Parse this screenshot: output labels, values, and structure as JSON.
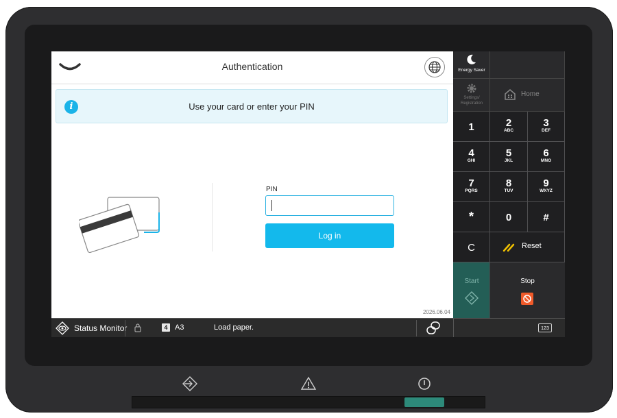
{
  "header": {
    "title": "Authentication"
  },
  "info_banner": {
    "message": "Use your card or enter your PIN"
  },
  "login_form": {
    "pin_label": "PIN",
    "pin_value": "",
    "login_button": "Log in"
  },
  "date": "2026.06.04",
  "status_bar": {
    "status_monitor": "Status Monitor",
    "tray_number": "4",
    "paper_size": "A3",
    "message": "Load paper.",
    "keyboard_label": "123"
  },
  "side_panel": {
    "energy_saver": "Energy Saver",
    "settings": "Settings/ Registration",
    "home": "Home",
    "reset": "Reset",
    "start": "Start",
    "stop": "Stop",
    "keys": [
      {
        "digit": "1",
        "letters": ""
      },
      {
        "digit": "2",
        "letters": "ABC"
      },
      {
        "digit": "3",
        "letters": "DEF"
      },
      {
        "digit": "4",
        "letters": "GHI"
      },
      {
        "digit": "5",
        "letters": "JKL"
      },
      {
        "digit": "6",
        "letters": "MNO"
      },
      {
        "digit": "7",
        "letters": "PQRS"
      },
      {
        "digit": "8",
        "letters": "TUV"
      },
      {
        "digit": "9",
        "letters": "WXYZ"
      },
      {
        "digit": "*",
        "letters": ""
      },
      {
        "digit": "0",
        "letters": ""
      },
      {
        "digit": "#",
        "letters": ""
      },
      {
        "digit": "C",
        "letters": ""
      }
    ]
  },
  "colors": {
    "accent": "#13b9ec",
    "start_button": "#235e56",
    "stop_icon": "#f05a2a",
    "info_background": "#e7f6fb"
  }
}
